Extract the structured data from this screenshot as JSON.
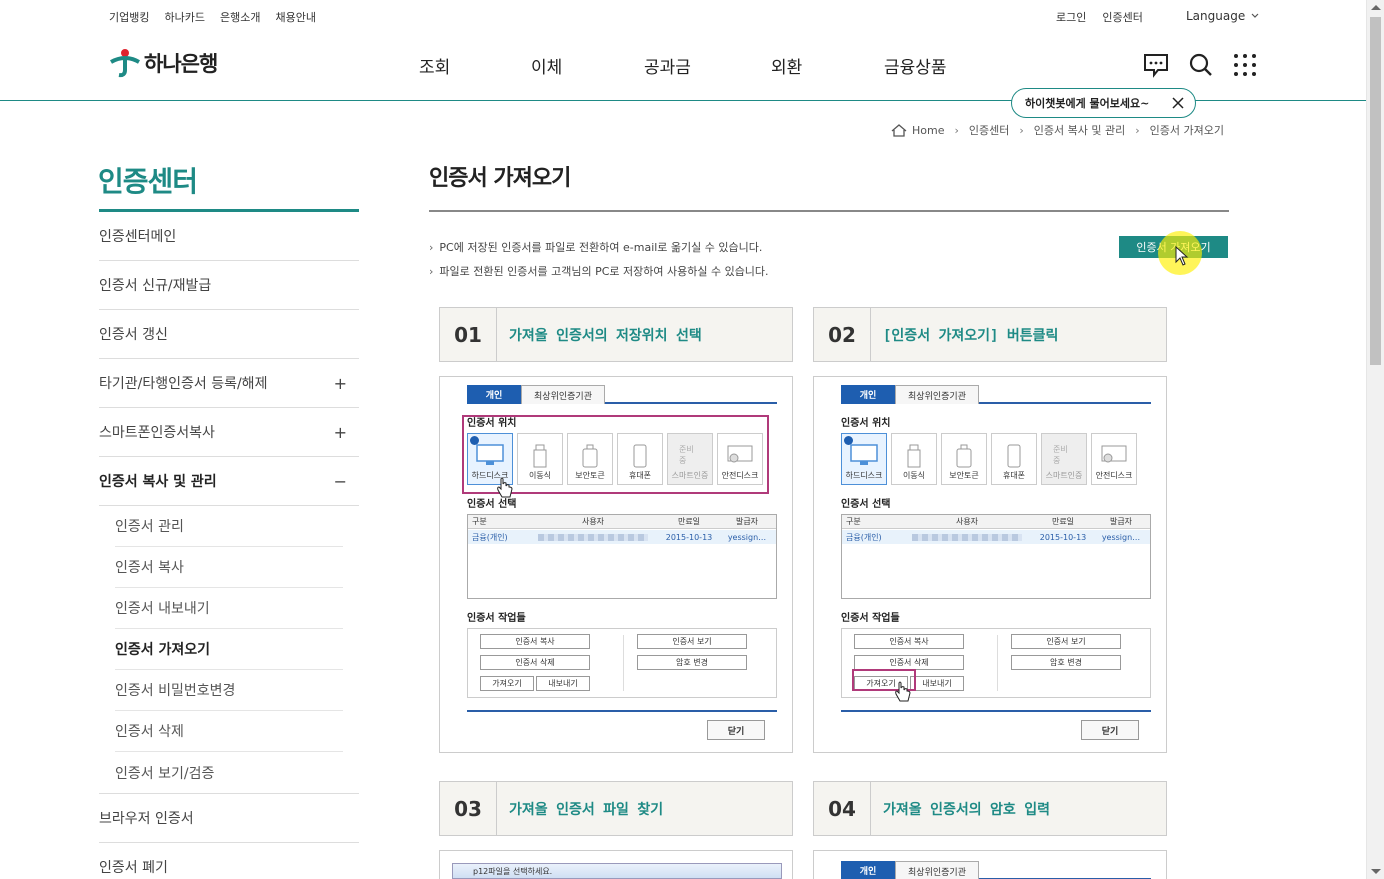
{
  "util": {
    "left_links": [
      "기업뱅킹",
      "하나카드",
      "은행소개",
      "채용안내"
    ],
    "right_links": [
      "로그인",
      "인증센터"
    ],
    "language": "Language"
  },
  "header": {
    "logo_text": "하나은행",
    "gnb": [
      "조회",
      "이체",
      "공과금",
      "외환",
      "금융상품"
    ],
    "chat_tip": "하이챗봇에게 물어보세요~"
  },
  "breadcrumb": [
    "Home",
    "인증센터",
    "인증서 복사 및 관리",
    "인증서 가져오기"
  ],
  "sidebar": {
    "title": "인증센터",
    "items": [
      {
        "label": "인증센터메인",
        "toggle": ""
      },
      {
        "label": "인증서 신규/재발급",
        "toggle": ""
      },
      {
        "label": "인증서 갱신",
        "toggle": ""
      },
      {
        "label": "타기관/타행인증서 등록/해제",
        "toggle": "+"
      },
      {
        "label": "스마트폰인증서복사",
        "toggle": "+"
      },
      {
        "label": "인증서 복사 및 관리",
        "toggle": "−"
      }
    ],
    "sub_items": [
      "인증서 관리",
      "인증서 복사",
      "인증서 내보내기",
      "인증서 가져오기",
      "인증서 비밀번호변경",
      "인증서 삭제",
      "인증서 보기/검증"
    ],
    "after_items": [
      "브라우저 인증서",
      "인증서 폐기"
    ]
  },
  "main": {
    "title": "인증서 가져오기",
    "desc": [
      "PC에 저장된 인증서를 파일로 전환하여 e-mail로 옮기실 수 있습니다.",
      "파일로 전환된 인증서를 고객님의 PC로 저장하여 사용하실 수 있습니다."
    ],
    "import_button": "인증서 가져오기"
  },
  "steps": [
    {
      "num": "01",
      "text": "가져올 인증서의 저장위치 선택"
    },
    {
      "num": "02",
      "text": "[인증서 가져오기] 버튼클릭"
    },
    {
      "num": "03",
      "text": "가져올 인증서 파일 찾기"
    },
    {
      "num": "04",
      "text": "가져올 인증서의 암호 입력"
    }
  ],
  "mock": {
    "tab_personal": "개인",
    "tab_root": "최상위인증기관",
    "sec_location": "인증서 위치",
    "locations": [
      "하드디스크",
      "이동식",
      "보안토큰",
      "휴대폰",
      "스마트인증",
      "안전디스크"
    ],
    "loc_pending": "준비중",
    "sec_select": "인증서 선택",
    "cols": [
      "구분",
      "사용자",
      "만료일",
      "발급자"
    ],
    "row": {
      "type": "금융(개인)",
      "expiry": "2015-10-13",
      "issuer": "yessign…"
    },
    "sec_ops": "인증서 작업들",
    "ops": {
      "copy": "인증서 복사",
      "delete": "인증서 삭제",
      "import": "가져오기",
      "export": "내보내기",
      "view": "인증서 보기",
      "pw": "암호 변경"
    },
    "close": "닫기",
    "file_dialog": "p12파일을 선택하세요."
  }
}
